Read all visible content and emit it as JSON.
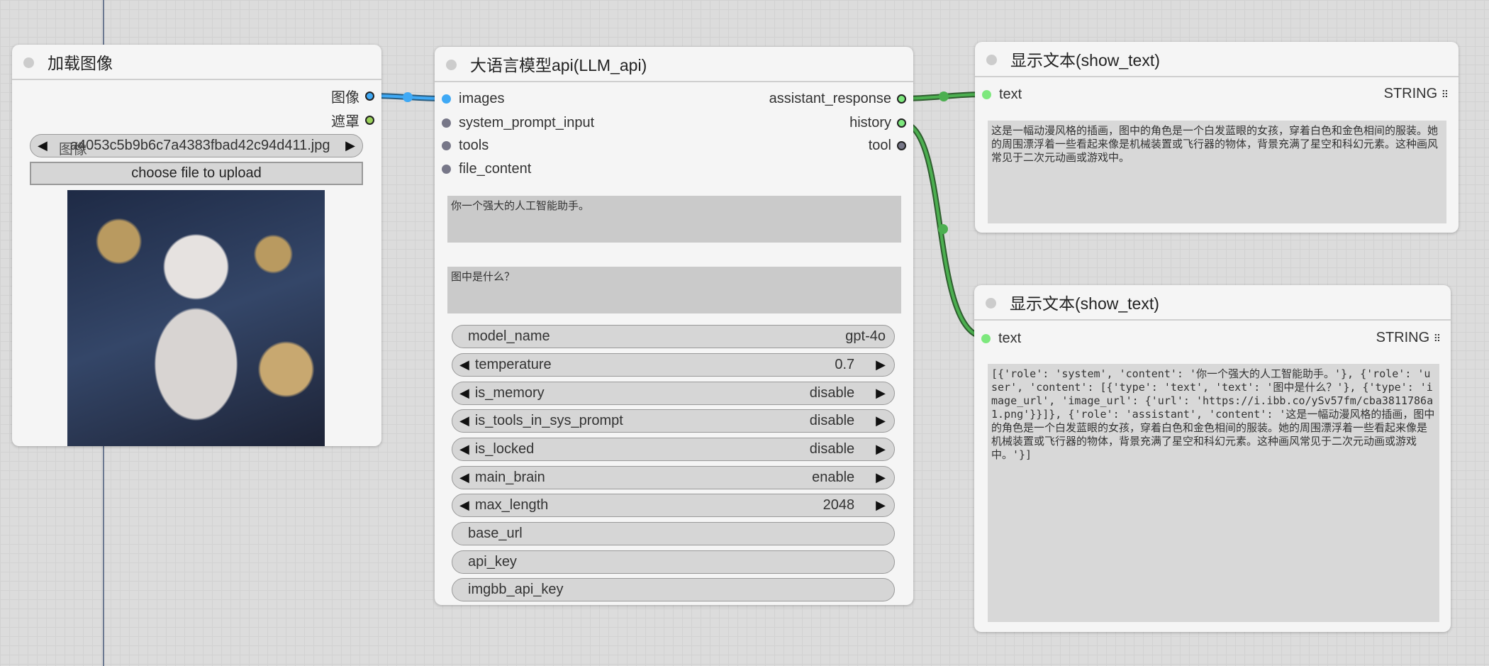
{
  "load_image": {
    "title": "加载图像",
    "outputs": [
      "图像",
      "遮罩"
    ],
    "image_label": "图像",
    "image_value": "a4053c5b9b6c7a4383fbad42c94d411.jpg",
    "upload_label": "choose file to upload"
  },
  "llm": {
    "title": "大语言模型api(LLM_api)",
    "inputs": [
      "images",
      "system_prompt_input",
      "tools",
      "file_content"
    ],
    "outputs": [
      "assistant_response",
      "history",
      "tool"
    ],
    "system_prompt": "你一个强大的人工智能助手。",
    "user_prompt": "图中是什么？",
    "widgets": [
      {
        "label": "model_name",
        "value": "gpt-4o"
      },
      {
        "label": "temperature",
        "value": "0.7"
      },
      {
        "label": "is_memory",
        "value": "disable"
      },
      {
        "label": "is_tools_in_sys_prompt",
        "value": "disable"
      },
      {
        "label": "is_locked",
        "value": "disable"
      },
      {
        "label": "main_brain",
        "value": "enable"
      },
      {
        "label": "max_length",
        "value": "2048"
      },
      {
        "label": "base_url",
        "value": ""
      },
      {
        "label": "api_key",
        "value": ""
      },
      {
        "label": "imgbb_api_key",
        "value": ""
      }
    ]
  },
  "show_text_1": {
    "title": "显示文本(show_text)",
    "input": "text",
    "type": "STRING",
    "text": "这是一幅动漫风格的插画，图中的角色是一个白发蓝眼的女孩，穿着白色和金色相间的服装。她的周围漂浮着一些看起来像是机械装置或飞行器的物体，背景充满了星空和科幻元素。这种画风常见于二次元动画或游戏中。"
  },
  "show_text_2": {
    "title": "显示文本(show_text)",
    "input": "text",
    "type": "STRING",
    "text": "[{'role': 'system', 'content': '你一个强大的人工智能助手。'}, {'role': 'user', 'content': [{'type': 'text', 'text': '图中是什么？'}, {'type': 'image_url', 'image_url': {'url': 'https://i.ibb.co/ySv57fm/cba3811786a1.png'}}]}, {'role': 'assistant', 'content': '这是一幅动漫风格的插画，图中的角色是一个白发蓝眼的女孩，穿着白色和金色相间的服装。她的周围漂浮着一些看起来像是机械装置或飞行器的物体，背景充满了星空和科幻元素。这种画风常见于二次元动画或游戏中。'}]"
  },
  "colors": {
    "image_link": "#3fa9f5",
    "string_link": "#4caf50"
  }
}
